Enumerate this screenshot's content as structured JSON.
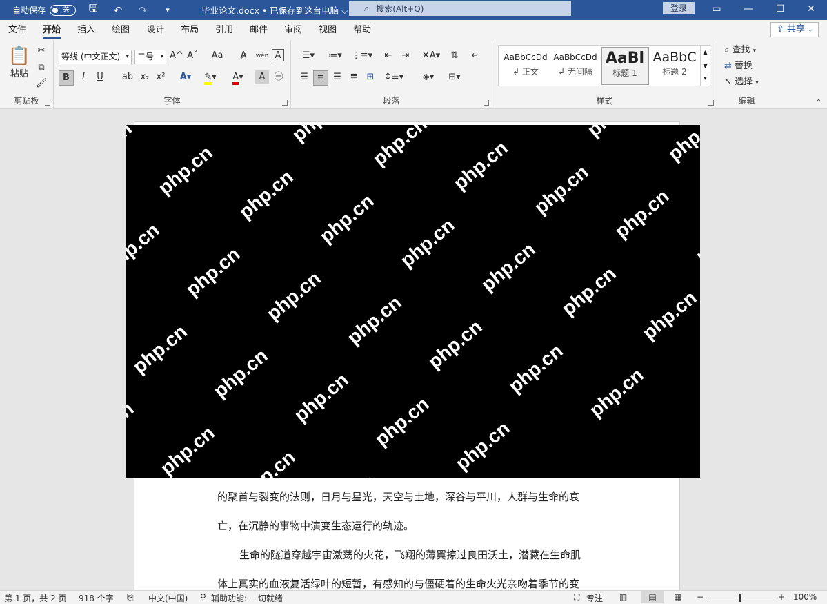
{
  "titlebar": {
    "autosave_label": "自动保存",
    "autosave_state": "关",
    "doc_title": "毕业论文.docx • 已保存到这台电脑 ⌵",
    "search_placeholder": "搜索(Alt+Q)",
    "login_label": "登录",
    "accent": "#2b579a"
  },
  "menu": {
    "tabs": [
      "文件",
      "开始",
      "插入",
      "绘图",
      "设计",
      "布局",
      "引用",
      "邮件",
      "审阅",
      "视图",
      "帮助"
    ],
    "active": "开始",
    "share_label": "共享"
  },
  "ribbon": {
    "clipboard": {
      "paste_label": "粘贴",
      "group_label": "剪贴板"
    },
    "font": {
      "font_name": "等线 (中文正文)",
      "font_size": "二号",
      "grow": "A^",
      "shrink": "Aˇ",
      "case": "Aa",
      "phonetic": "wén",
      "bold": "B",
      "italic": "I",
      "underline": "U",
      "strike": "ab",
      "subscript": "x₂",
      "superscript": "x²",
      "group_label": "字体"
    },
    "paragraph": {
      "group_label": "段落"
    },
    "styles": {
      "items": [
        {
          "sample": "AaBbCcDd",
          "name": "↲ 正文"
        },
        {
          "sample": "AaBbCcDd",
          "name": "↲ 无间隔"
        },
        {
          "sample": "AaBl",
          "name": "标题 1"
        },
        {
          "sample": "AaBbC",
          "name": "标题 2"
        }
      ],
      "group_label": "样式"
    },
    "editing": {
      "find": "查找",
      "replace": "替换",
      "select": "选择",
      "group_label": "编辑"
    }
  },
  "document": {
    "watermark_text": "php.cn",
    "paragraphs": [
      "的聚首与裂变的法则，日月与星光，天空与土地，深谷与平川，人群与生命的衰",
      "亡，在沉静的事物中演变生态运行的轨迹。",
      "生命的隧道穿越宇宙激荡的火花，飞翔的薄翼掠过良田沃土，潜藏在生命肌",
      "体上真实的血液复活绿叶的短暂，有感知的与僵硬着的生命火光亲吻着季节的变"
    ]
  },
  "statusbar": {
    "page": "第 1 页，共 2 页",
    "words": "918 个字",
    "language": "中文(中国)",
    "accessibility": "辅助功能: 一切就绪",
    "focus": "专注",
    "zoom": "100%",
    "zoom_level": 1.0
  }
}
